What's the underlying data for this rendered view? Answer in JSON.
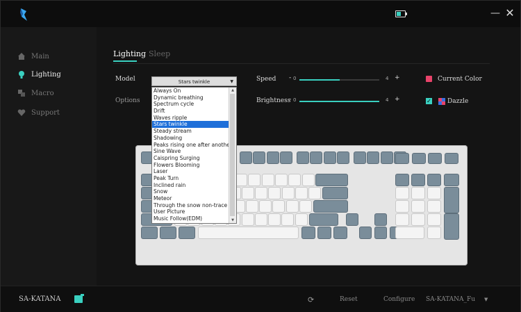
{
  "window": {
    "icons": [
      "app-logo-icon",
      "battery-icon",
      "minimize-icon",
      "close-icon"
    ],
    "minimize_glyph": "—",
    "close_glyph": "✕"
  },
  "sidebar": {
    "items": [
      {
        "label": "Main",
        "icon": "home-icon",
        "active": false
      },
      {
        "label": "Lighting",
        "icon": "bulb-icon",
        "active": true
      },
      {
        "label": "Macro",
        "icon": "macro-icon",
        "active": false
      },
      {
        "label": "Support",
        "icon": "heart-icon",
        "active": false
      }
    ]
  },
  "tabs": [
    {
      "label": "Lighting",
      "active": true
    },
    {
      "label": "Sleep",
      "active": false
    }
  ],
  "lighting": {
    "model_label": "Model",
    "options_label": "Options",
    "model_selected": "Stars twinkle",
    "model_options": [
      "Always On",
      "Dynamic breathing",
      "Spectrum cycle",
      "Drift",
      "Waves ripple",
      "Stars twinkle",
      "Steady stream",
      "Shadowing",
      "Peaks rising one after another",
      "Sine Wave",
      "Caispring Surging",
      "Flowers Blooming",
      "Laser",
      "Peak Turn",
      "Inclined rain",
      "Snow",
      "Meteor",
      "Through the snow non-trace",
      "User Picture",
      "Music Follow(EDM)"
    ],
    "speed": {
      "label": "Speed",
      "min": "0",
      "max": "4",
      "value": 2,
      "minus": "-",
      "plus": "+"
    },
    "brightness": {
      "label": "Brightness",
      "min": "0",
      "max": "4",
      "value": 4,
      "minus": "-",
      "plus": "+"
    },
    "current_color": {
      "label": "Current Color",
      "color": "#e8436a"
    },
    "dazzle": {
      "label": "Dazzle",
      "checked": true,
      "check_glyph": "✓"
    }
  },
  "colors": {
    "accent": "#3ad0c0",
    "key_gray": "#7a8d9a",
    "key_white": "#f4f4f4"
  },
  "footer": {
    "device": "SA-KATANA",
    "reset_label": "Reset",
    "configure_label": "Configure",
    "config_value": "SA-KATANA_Fu",
    "refresh_glyph": "⟳",
    "dropdown_glyph": "▼"
  }
}
